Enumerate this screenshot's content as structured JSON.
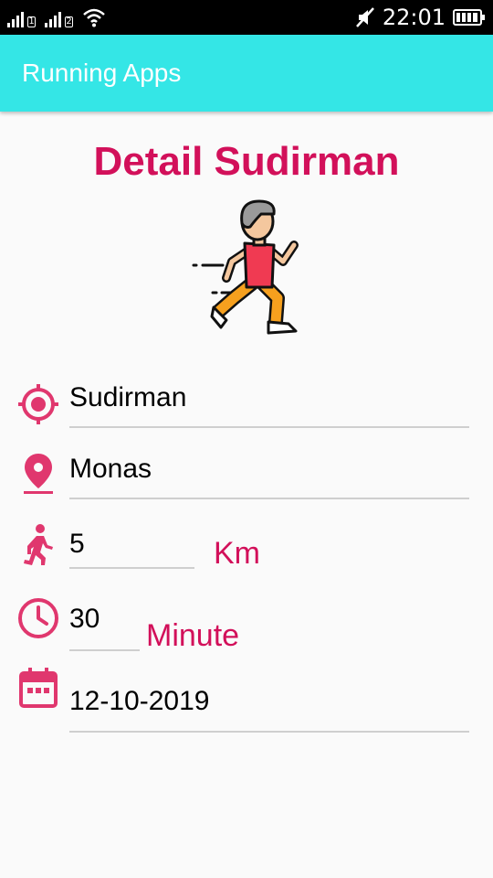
{
  "status_bar": {
    "time": "22:01"
  },
  "app_bar": {
    "title": "Running Apps"
  },
  "detail": {
    "heading": "Detail Sudirman",
    "runner_image": "runner-illustration",
    "name": "Sudirman",
    "location": "Monas",
    "distance_value": "5",
    "distance_unit": "Km",
    "duration_value": "30",
    "duration_unit": "Minute",
    "date": "12-10-2019"
  },
  "icons": {
    "name": "target-icon",
    "location": "location-pin-icon",
    "distance": "running-person-icon",
    "duration": "clock-icon",
    "date": "calendar-icon"
  },
  "colors": {
    "accent": "#d2105a",
    "icon": "#e0376e",
    "app_bar": "#34e6e6"
  }
}
